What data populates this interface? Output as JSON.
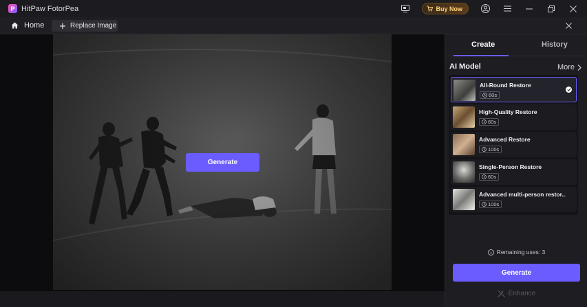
{
  "app": {
    "title": "HitPaw FotorPea",
    "logo_letter": "P"
  },
  "titlebar": {
    "buy_label": "Buy Now"
  },
  "tabs": {
    "home_label": "Home",
    "replace_label": "Replace Image"
  },
  "canvas": {
    "generate_label": "Generate"
  },
  "panel": {
    "tab_create": "Create",
    "tab_history": "History",
    "section_title": "AI Model",
    "more_label": "More",
    "models": [
      {
        "name": "All-Round Restore",
        "time": "60s",
        "selected": true
      },
      {
        "name": "High-Quality Restore",
        "time": "60s",
        "selected": false
      },
      {
        "name": "Advanced Restore",
        "time": "100s",
        "selected": false
      },
      {
        "name": "Single-Person Restore",
        "time": "60s",
        "selected": false
      },
      {
        "name": "Advanced multi-person restor...",
        "time": "100s",
        "selected": false
      }
    ],
    "remaining_label": "Remaining uses: 3",
    "generate_label": "Generate",
    "enhance_label": "Enhance"
  },
  "colors": {
    "accent": "#6a5cff",
    "panel_bg": "#1d1d22",
    "titlebar_bg": "#1c1c20"
  }
}
